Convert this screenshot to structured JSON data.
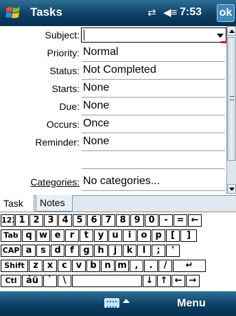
{
  "titlebar": {
    "title": "Tasks",
    "connectivity_icon": "connectivity-icon",
    "volume_icon": "volume-icon",
    "time": "7:53",
    "ok_label": "ok"
  },
  "form": {
    "subject": {
      "label": "Subject:",
      "value": ""
    },
    "priority": {
      "label": "Priority:",
      "value": "Normal"
    },
    "status": {
      "label": "Status:",
      "value": "Not Completed"
    },
    "starts": {
      "label": "Starts:",
      "value": "None"
    },
    "due": {
      "label": "Due:",
      "value": "None"
    },
    "occurs": {
      "label": "Occurs:",
      "value": "Once"
    },
    "reminder": {
      "label": "Reminder:",
      "value": "None"
    },
    "categories": {
      "label": "Categories:",
      "value": "No categories..."
    }
  },
  "tabs": [
    {
      "label": "Task",
      "active": true
    },
    {
      "label": "Notes",
      "active": false
    }
  ],
  "keyboard": {
    "rows": [
      [
        "123",
        "1",
        "2",
        "3",
        "4",
        "5",
        "6",
        "7",
        "8",
        "9",
        "0",
        "-",
        "=",
        "←"
      ],
      [
        "Tab",
        "q",
        "w",
        "e",
        "r",
        "t",
        "y",
        "u",
        "i",
        "o",
        "p",
        "[",
        "]"
      ],
      [
        "CAP",
        "a",
        "s",
        "d",
        "f",
        "g",
        "h",
        "j",
        "k",
        "l",
        ";",
        "'"
      ],
      [
        "Shift",
        "z",
        "x",
        "c",
        "v",
        "b",
        "n",
        "m",
        ",",
        ".",
        "/",
        "↵"
      ],
      [
        "Ctl",
        "áü",
        "`",
        "\\",
        " ",
        "↓",
        "↑",
        "←",
        "→"
      ]
    ]
  },
  "bottombar": {
    "menu_label": "Menu",
    "input_icon": "keyboard-icon"
  },
  "colors": {
    "titlebar": "#0c3f63",
    "accent": "#3f88b9",
    "marker": "#e00000"
  }
}
